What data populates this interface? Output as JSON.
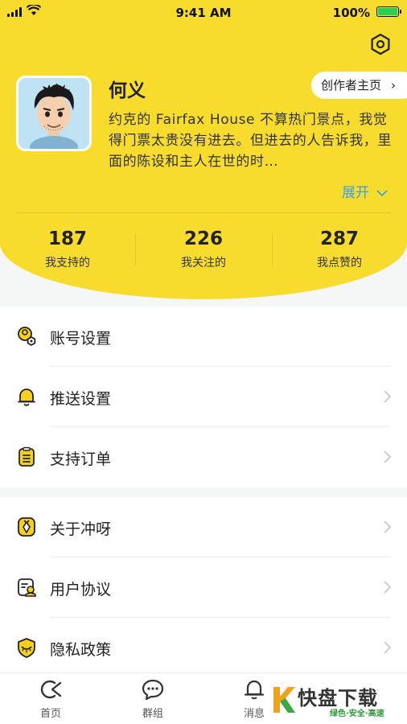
{
  "status_bar": {
    "time": "9:41 AM",
    "battery": "100%"
  },
  "profile": {
    "name": "何义",
    "creator_button": "创作者主页",
    "bio": "约克的 Fairfax House 不算热门景点，我觉得门票太贵没有进去。但进去的人告诉我，里面的陈设和主人在世的时…",
    "expand": "展开"
  },
  "stats": [
    {
      "value": "187",
      "label": "我支持的"
    },
    {
      "value": "226",
      "label": "我关注的"
    },
    {
      "value": "287",
      "label": "我点赞的"
    }
  ],
  "menu_group_1": [
    {
      "label": "账号设置",
      "icon": "account-settings-icon"
    },
    {
      "label": "推送设置",
      "icon": "bell-icon"
    },
    {
      "label": "支持订单",
      "icon": "clipboard-icon"
    }
  ],
  "menu_group_2": [
    {
      "label": "关于冲呀",
      "icon": "about-icon"
    },
    {
      "label": "用户协议",
      "icon": "agreement-icon"
    },
    {
      "label": "隐私政策",
      "icon": "shield-icon"
    }
  ],
  "tabs": [
    {
      "label": "首页",
      "icon": "home-icon"
    },
    {
      "label": "群组",
      "icon": "chat-icon"
    },
    {
      "label": "消息",
      "icon": "bell-icon"
    }
  ],
  "watermark": {
    "title": "快盘下载",
    "subtitle": "绿色·安全·高速"
  },
  "colors": {
    "header_yellow": "#f7dc2e",
    "accent_blue": "#3a9ee8",
    "icon_yellow": "#f5d020"
  }
}
